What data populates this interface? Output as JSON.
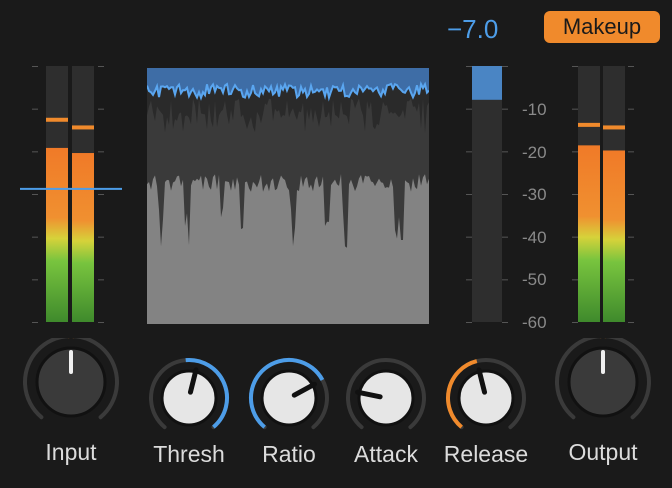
{
  "header": {
    "gain_readout": "−7.0",
    "makeup_label": "Makeup"
  },
  "scale": {
    "labels": [
      "-10",
      "-20",
      "-30",
      "-40",
      "-50",
      "-60"
    ]
  },
  "meters": {
    "input": {
      "left_level": 0.68,
      "right_level": 0.66,
      "left_peak": 0.79,
      "right_peak": 0.76,
      "threshold_marker": 0.52
    },
    "output": {
      "left_level": 0.69,
      "right_level": 0.67,
      "left_peak": 0.77,
      "right_peak": 0.76
    },
    "gain_reduction": {
      "level": 0.055
    }
  },
  "knobs": [
    {
      "id": "input",
      "label": "Input",
      "value": 0.5,
      "style": "dark",
      "arc_color": "#f08a2c",
      "arc": "center-dot"
    },
    {
      "id": "thresh",
      "label": "Thresh",
      "value": 0.55,
      "style": "light",
      "arc_color": "#4d9de8",
      "arc": "from-top"
    },
    {
      "id": "ratio",
      "label": "Ratio",
      "value": 0.72,
      "style": "light",
      "arc_color": "#4d9de8",
      "arc": "from-start"
    },
    {
      "id": "attack",
      "label": "Attack",
      "value": 0.22,
      "style": "light",
      "arc_color": "#4d9de8",
      "arc": "none"
    },
    {
      "id": "release",
      "label": "Release",
      "value": 0.45,
      "style": "light",
      "arc_color": "#f08a2c",
      "arc": "from-start"
    },
    {
      "id": "output",
      "label": "Output",
      "value": 0.5,
      "style": "dark",
      "arc_color": "#f08a2c",
      "arc": "center-dot"
    }
  ],
  "colors": {
    "background": "#1a1a1a",
    "accent_blue": "#4d9de8",
    "accent_orange": "#f08a2c",
    "meter_green": "#6dbb3a",
    "meter_yellow": "#d8d03a",
    "meter_orange": "#f08a2c"
  }
}
